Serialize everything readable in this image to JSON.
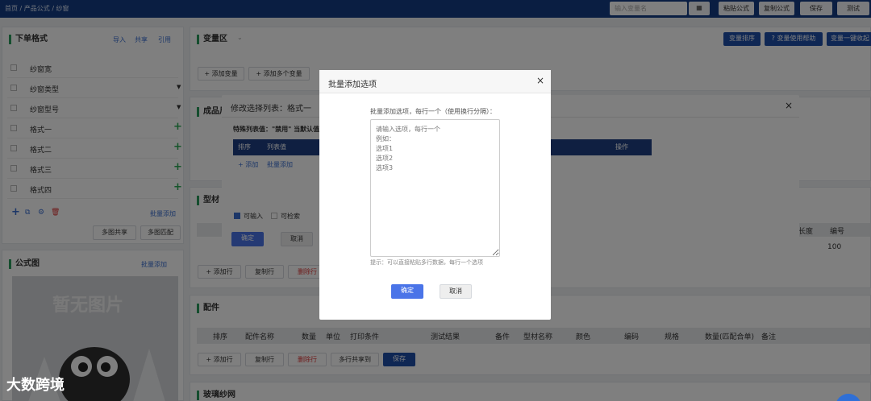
{
  "topbar": {
    "breadcrumb": "首页 / 产品公式 / 纱窗",
    "search_placeholder": "输入变量名",
    "btn_copy_formula": "粘贴公式",
    "btn_dup_formula": "复制公式",
    "btn_save": "保存",
    "btn_test": "测试"
  },
  "left": {
    "title": "下单格式",
    "link_import": "导入",
    "link_share": "共享",
    "link_ref": "引用",
    "items": [
      {
        "label": "纱窗宽"
      },
      {
        "label": "纱窗类型"
      },
      {
        "label": "纱窗型号"
      },
      {
        "label": "格式一"
      },
      {
        "label": "格式二"
      },
      {
        "label": "格式三"
      },
      {
        "label": "格式四"
      }
    ],
    "batch_add": "批量添加",
    "btn_multi_share": "多图共享",
    "btn_multi_match": "多图匹配"
  },
  "formula_img": {
    "title": "公式图",
    "link_batch": "批量添加",
    "no_image": "暂无图片"
  },
  "watermark": "大数跨境",
  "var_section": {
    "title": "变量区",
    "btn_sort": "变量排序",
    "btn_help": "? 变量使用帮助",
    "btn_one_key": "变量一键收起",
    "btn_add_var": "+ 添加变量",
    "btn_add_multi": "+ 添加多个变量"
  },
  "product_section": {
    "title": "成品尺寸"
  },
  "material_section": {
    "title": "型材",
    "col_length": "长度",
    "col_number": "编号",
    "val_number": "100",
    "btn_add_row": "+ 添加行",
    "btn_copy_row": "复制行",
    "btn_del_row": "删除行"
  },
  "parts_section": {
    "title": "配件",
    "cols": [
      "排序",
      "配件名称",
      "数量",
      "单位",
      "打印条件",
      "测试结果",
      "备件",
      "型材名称",
      "颜色",
      "编码",
      "规格",
      "数量(匹配合单)",
      "备注"
    ],
    "btn_add_row": "+ 添加行",
    "btn_copy_row": "复制行",
    "btn_del_row": "删除行",
    "btn_multi_copy": "多行共享到",
    "btn_save": "保存"
  },
  "glass_section": {
    "title": "玻璃纱网"
  },
  "mid_modal": {
    "title": "修改选择列表：格式一",
    "special_label": "特殊列表值：\"禁用\" 当默认值",
    "cols": [
      "排序",
      "列表值",
      "",
      "",
      "操作"
    ],
    "link_add": "+ 添加",
    "link_batch": "批量添加",
    "cb_input": "可输入",
    "cb_search": "可检索",
    "btn_ok": "确定",
    "btn_cancel": "取消"
  },
  "batch_modal": {
    "title": "批量添加选项",
    "close": "×",
    "instruction": "批量添加选项，每行一个（使用换行分隔）：",
    "textarea_placeholder": "请输入选项，每行一个\n例如：\n选项1\n选项2\n选项3",
    "hint": "提示：可以直接粘贴多行数据，每行一个选项",
    "btn_ok": "确定",
    "btn_cancel": "取消"
  },
  "colors": {
    "topbar": "#143d84",
    "accent_green": "#2bab55",
    "primary_blue": "#4a74e8",
    "table_header": "#1e3f82"
  }
}
